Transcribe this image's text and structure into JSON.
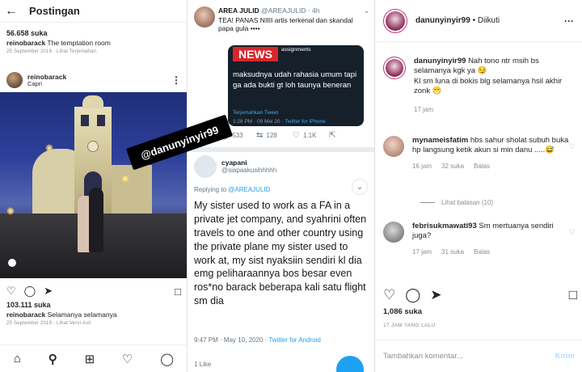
{
  "panel1": {
    "back_icon": "arrow-left",
    "title": "Postingan",
    "prev_post": {
      "likes": "56.658 suka",
      "caption_user": "reinobarack",
      "caption_text": "The temptation room",
      "date": "25 September 2019",
      "translate": "Lihat Terjemahan"
    },
    "post": {
      "username": "reinobarack",
      "location": "Capri",
      "watermark": "@danunyinyir99",
      "likes": "103.111 suka",
      "caption_user": "reinobarack",
      "caption_text": "Selamanya selamanya",
      "date": "25 September 2019",
      "original": "Lihat Versi Asli"
    }
  },
  "panel2": {
    "tweet1": {
      "name": "AREA JULID",
      "handle": "@AREAJULID",
      "age": "4h",
      "text": "TEA! PANAS NIIII artis terkenal dan skandal papa gula ••••",
      "quote_badge": "NEWS",
      "quote_tag": "assignments",
      "quote_text": "maksudnya udah rahasia umum tapi ga ada bukti gt loh taunya beneran",
      "quote_translate": "Terjemahkan Tweet",
      "quote_time": "1:28 PM · 09 Mei 20 ·",
      "quote_source": "Twitter for iPhone",
      "replies": "533",
      "retweets": "128",
      "likes": "1.1K"
    },
    "tweet2": {
      "name": "cyapani",
      "handle": "@siapaakusihhhhh",
      "replying_prefix": "Replying to",
      "replying_to": "@AREAJULID",
      "text": "My sister used to work as a FA in a private jet company,  and syahrini often travels to one and other country using the private plane my sister used to work at, my sist nyaksiin sendiri kl dia emg peliharaannya bos besar even ros*no barack beberapa kali satu flight sm dia",
      "time": "9:47 PM · May 10, 2020 ·",
      "source": "Twitter for Android",
      "likes": "1 Like"
    }
  },
  "panel3": {
    "username": "danunyinyir99",
    "follow": "• Diikuti",
    "caption": {
      "user": "danunyinyir99",
      "text": "Nah tono ntr msih bs selamanya kgk ya 😏",
      "text2": "Kl sm luna di bokis blg selamanya hsil akhir zonk 😁",
      "time": "17 jam"
    },
    "comments": [
      {
        "user": "mynameisfatim",
        "text": "hbs sahur sholat subuh buka hp langsung ketik akun si min danu .....😅",
        "time": "16 jam",
        "likes": "32 suka",
        "reply": "Balas",
        "view_replies": "Lihat balasan (10)"
      },
      {
        "user": "febrisukmawati93",
        "text": "Sm mertuanya sendiri juga?",
        "time": "17 jam",
        "likes": "31 suka",
        "reply": "Balas"
      }
    ],
    "likes": "1,086 suka",
    "ago": "17 JAM YANG LALU",
    "input_placeholder": "Tambahkan komentar...",
    "send": "Kirim"
  },
  "colors": {
    "news_red": "#d7262b",
    "twitter_blue": "#1da1f2",
    "quote_bg": "#15202b",
    "ig_send": "#b3dbff"
  }
}
